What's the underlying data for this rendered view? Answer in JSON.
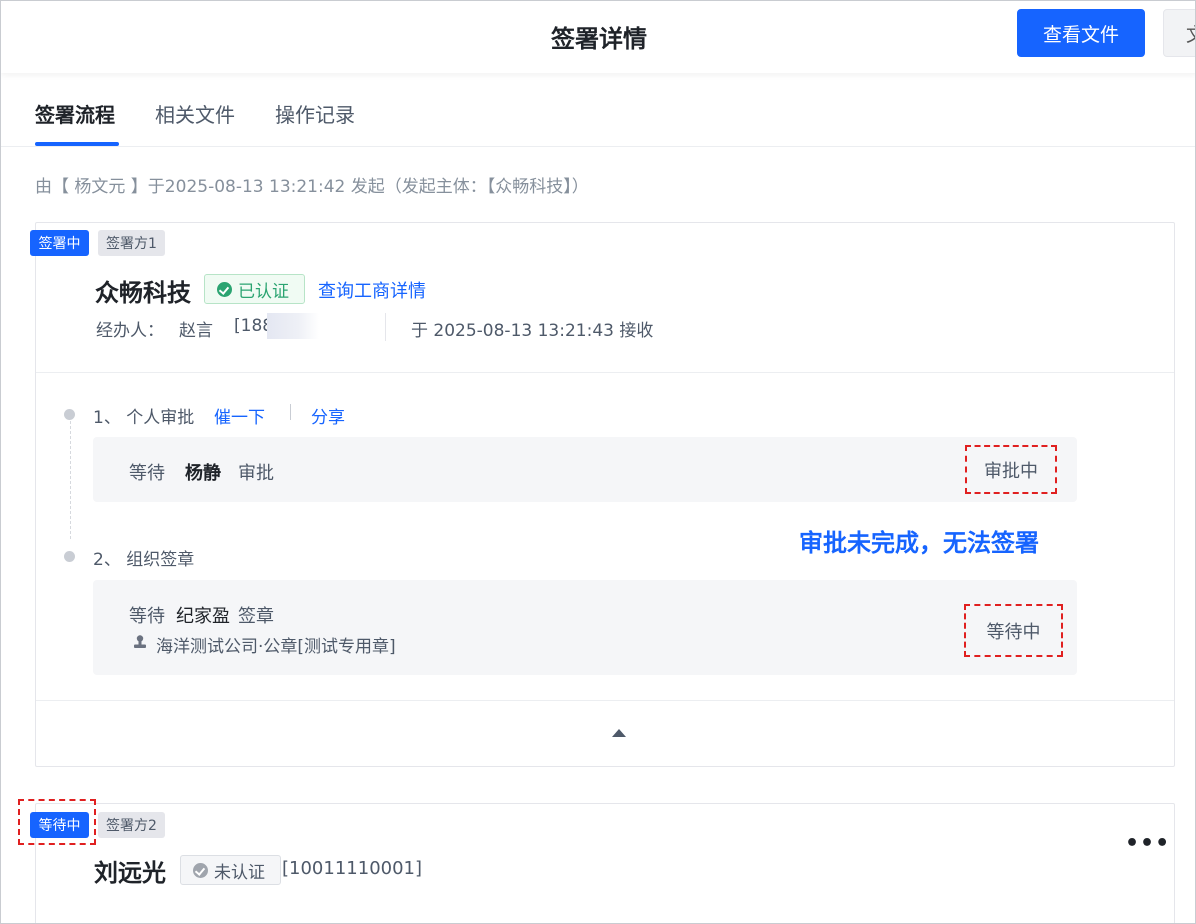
{
  "header": {
    "title": "签署详情",
    "view_button": "查看文件",
    "cut_button": "文"
  },
  "tabs": [
    {
      "label": "签署流程"
    },
    {
      "label": "相关文件"
    },
    {
      "label": "操作记录"
    }
  ],
  "initiated_text": "由【 杨文元 】于2025-08-13 13:21:42 发起（发起主体：【众畅科技】）",
  "signer1": {
    "status_badge": "签署中",
    "party_badge": "签署方1",
    "company": "众畅科技",
    "verified": "已认证",
    "query_link": "查询工商详情",
    "handler_label": "经办人：",
    "handler_name": "赵言",
    "handler_phone": "[188",
    "received": "于 2025-08-13 13:21:43 接收",
    "steps": [
      {
        "title": "1、 个人审批",
        "links": [
          "催一下",
          "分享"
        ],
        "wait": "等待",
        "person": "杨静",
        "action": "审批",
        "status": "审批中"
      },
      {
        "title": "2、 组织签章",
        "wait": "等待",
        "person": "纪家盈",
        "action": "签章",
        "seal": "海洋测试公司·公章[测试专用章]",
        "status": "等待中"
      }
    ]
  },
  "annotation": "审批未完成，无法签署",
  "signer2": {
    "status_badge": "等待中",
    "party_badge": "签署方2",
    "name": "刘远光",
    "verified": "未认证",
    "phone": "[10011110001]",
    "more": "•••"
  },
  "colors": {
    "accent": "#1664ff",
    "success": "#2ba471",
    "highlight": "#e02020"
  }
}
